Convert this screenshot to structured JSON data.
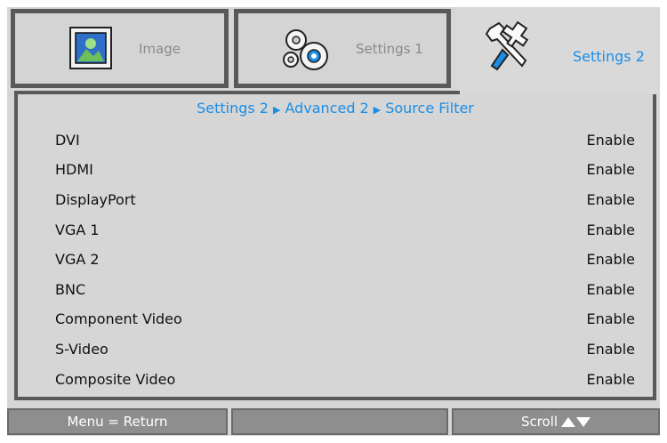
{
  "tabs": [
    {
      "label": "Image",
      "icon": "image-icon",
      "active": false
    },
    {
      "label": "Settings 1",
      "icon": "gears-icon",
      "active": false
    },
    {
      "label": "Settings 2",
      "icon": "tools-icon",
      "active": true
    }
  ],
  "breadcrumb": {
    "items": [
      "Settings 2",
      "Advanced 2",
      "Source Filter"
    ],
    "separator_icon": "triangle-right-icon"
  },
  "rows": [
    {
      "label": "DVI",
      "value": "Enable"
    },
    {
      "label": "HDMI",
      "value": "Enable"
    },
    {
      "label": "DisplayPort",
      "value": "Enable"
    },
    {
      "label": "VGA 1",
      "value": "Enable"
    },
    {
      "label": "VGA 2",
      "value": "Enable"
    },
    {
      "label": "BNC",
      "value": "Enable"
    },
    {
      "label": "Component Video",
      "value": "Enable"
    },
    {
      "label": "S-Video",
      "value": "Enable"
    },
    {
      "label": "Composite Video",
      "value": "Enable"
    }
  ],
  "footer": {
    "menu_return": "Menu = Return",
    "middle": "",
    "scroll": "Scroll"
  },
  "colors": {
    "accent": "#1a8ee6",
    "border": "#595959",
    "panel": "#d6d6d6",
    "footer_button": "#8e8e8e"
  }
}
